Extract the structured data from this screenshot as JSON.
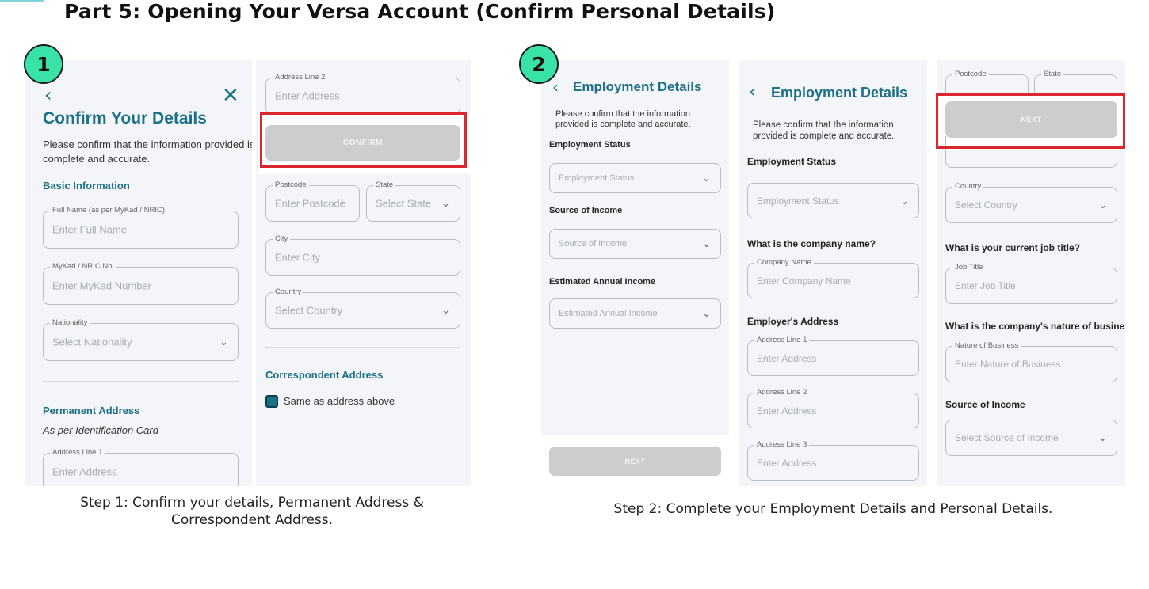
{
  "page": {
    "title": "Part 5: Opening Your Versa Account (Confirm Personal Details)",
    "accent_color": "#1b6f86",
    "badge_color": "#39e3a8",
    "highlight_color": "#d9262f"
  },
  "step1": {
    "badge": "1",
    "caption_line1": "Step 1: Confirm your details, Permanent Address &",
    "caption_line2": "Correspondent Address.",
    "screen_a": {
      "back_icon": "chevron-left-icon",
      "close_icon": "close-icon",
      "title": "Confirm Your Details",
      "intro_line1": "Please confirm that the information provided is",
      "intro_line2": "complete and accurate.",
      "basic_heading": "Basic Information",
      "full_name": {
        "label": "Full Name (as per MyKad / NRIC)",
        "placeholder": "Enter Full Name"
      },
      "mykad": {
        "label": "MyKad / NRIC No.",
        "placeholder": "Enter MyKad Number"
      },
      "nationality": {
        "label": "Nationality",
        "placeholder": "Select Nationality"
      },
      "permanent_heading": "Permanent Address",
      "permanent_sub": "As per Identification Card",
      "address_line1": {
        "label": "Address Line 1",
        "placeholder": "Enter Address"
      }
    },
    "screen_b": {
      "address_line2": {
        "label": "Address Line 2",
        "placeholder": "Enter Address"
      },
      "confirm_button": "CONFIRM",
      "postcode": {
        "label": "Postcode",
        "placeholder": "Enter Postcode"
      },
      "state": {
        "label": "State",
        "placeholder": "Select State"
      },
      "city": {
        "label": "City",
        "placeholder": "Enter City"
      },
      "country": {
        "label": "Country",
        "placeholder": "Select Country"
      },
      "correspondent_heading": "Correspondent Address",
      "same_as_above": "Same as address above",
      "same_as_above_checked": true
    }
  },
  "step2": {
    "badge": "2",
    "caption": "Step 2: Complete your Employment Details and Personal Details.",
    "screen_c": {
      "title": "Employment Details",
      "intro_line1": "Please confirm that the information",
      "intro_line2": "provided is complete and accurate.",
      "employment_status_label": "Employment Status",
      "employment_status_placeholder": "Employment Status",
      "source_label": "Source of Income",
      "source_placeholder": "Source of Income",
      "annual_label": "Estimated Annual Income",
      "annual_placeholder": "Estimated Annual Income",
      "next_button": "NEXT"
    },
    "screen_d": {
      "title": "Employment Details",
      "intro_line1": "Please confirm that the information",
      "intro_line2": "provided is complete and accurate.",
      "employment_status_label": "Employment Status",
      "employment_status_placeholder": "Employment Status",
      "company_question": "What is the company name?",
      "company": {
        "label": "Company Name",
        "placeholder": "Enter Company Name"
      },
      "employer_heading": "Employer's Address",
      "address_line1": {
        "label": "Address Line 1",
        "placeholder": "Enter Address"
      },
      "address_line2": {
        "label": "Address Line 2",
        "placeholder": "Enter Address"
      },
      "address_line3": {
        "label": "Address Line 3",
        "placeholder": "Enter Address"
      }
    },
    "screen_e": {
      "postcode_label": "Postcode",
      "state_label": "State",
      "next_button": "NEXT",
      "country": {
        "label": "Country",
        "placeholder": "Select Country"
      },
      "job_question": "What is your current job title?",
      "job": {
        "label": "Job Title",
        "placeholder": "Enter Job Title"
      },
      "nature_question": "What is the company's nature of business?",
      "nature": {
        "label": "Nature of Business",
        "placeholder": "Enter Nature of Business"
      },
      "source_heading": "Source of Income",
      "source_placeholder": "Select Source of Income"
    }
  }
}
